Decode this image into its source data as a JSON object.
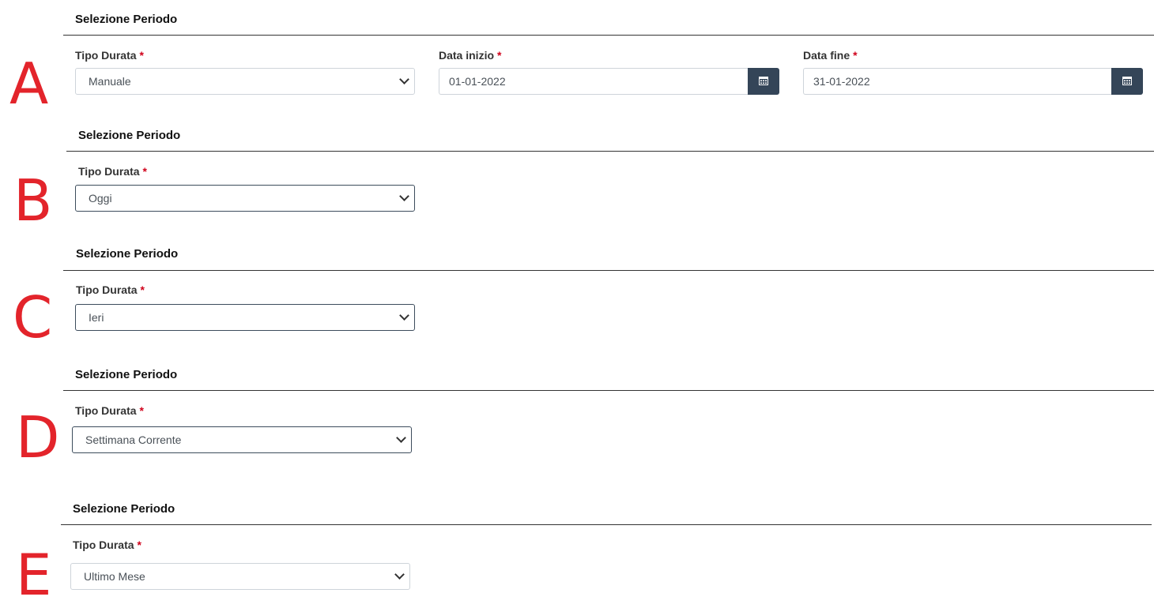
{
  "sections": [
    {
      "letter": "A",
      "title": "Selezione Periodo",
      "tipo_label": "Tipo Durata",
      "tipo_value": "Manuale",
      "data_inizio_label": "Data inizio",
      "data_inizio_value": "01-01-2022",
      "data_fine_label": "Data fine",
      "data_fine_value": "31-01-2022"
    },
    {
      "letter": "B",
      "title": "Selezione Periodo",
      "tipo_label": "Tipo Durata",
      "tipo_value": "Oggi"
    },
    {
      "letter": "C",
      "title": "Selezione Periodo",
      "tipo_label": "Tipo Durata",
      "tipo_value": "Ieri"
    },
    {
      "letter": "D",
      "title": "Selezione Periodo",
      "tipo_label": "Tipo Durata",
      "tipo_value": "Settimana Corrente"
    },
    {
      "letter": "E",
      "title": "Selezione Periodo",
      "tipo_label": "Tipo Durata",
      "tipo_value": "Ultimo Mese"
    }
  ],
  "required_marker": "*",
  "icons": {
    "select_arrow": "chevron-down-icon",
    "date_picker": "calendar-icon"
  },
  "colors": {
    "annotation": "#e3242b",
    "calendar_button": "#344558",
    "required": "#d0021b"
  }
}
